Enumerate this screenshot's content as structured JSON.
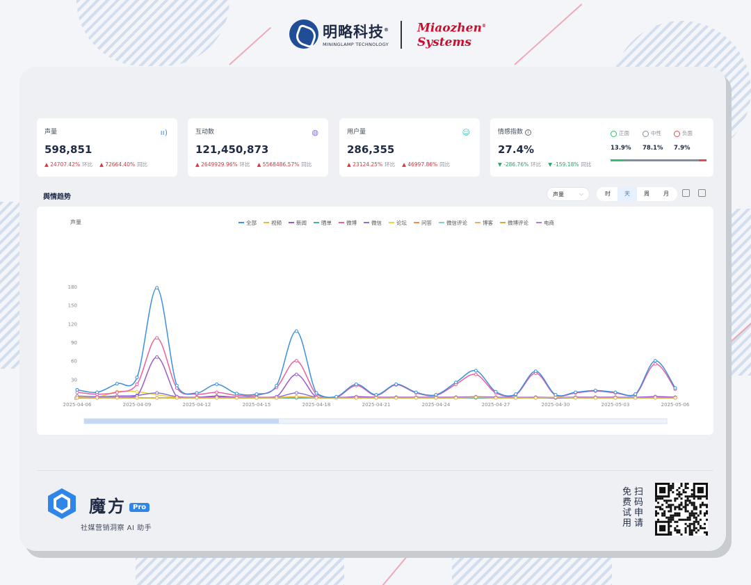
{
  "brand": {
    "partner_cn": "明略科技",
    "partner_reg": "®",
    "partner_en": "MININGLAMP TECHNOLOGY",
    "miaozhen_line1": "Miaozhen",
    "miaozhen_line2": "Systems",
    "miaozhen_reg": "®"
  },
  "kpis": [
    {
      "title": "声量",
      "value": "598,851",
      "chg1": "24707.42%",
      "chg1_label": "环比",
      "chg2": "72664.40%",
      "chg2_label": "同比",
      "icon": "sound-wave-icon"
    },
    {
      "title": "互动数",
      "value": "121,450,873",
      "chg1": "2649929.96%",
      "chg1_label": "环比",
      "chg2": "5568486.57%",
      "chg2_label": "同比",
      "icon": "chat-icon"
    },
    {
      "title": "用户量",
      "value": "286,355",
      "chg1": "23124.25%",
      "chg1_label": "环比",
      "chg2": "46997.86%",
      "chg2_label": "同比",
      "icon": "users-icon"
    }
  ],
  "sentiment": {
    "title": "情感指数",
    "value": "27.4%",
    "chg1": "-286.76%",
    "chg1_label": "环比",
    "chg2": "-159.18%",
    "chg2_label": "同比",
    "positive_label": "正面",
    "positive": "13.9%",
    "neutral_label": "中性",
    "neutral": "78.1%",
    "negative_label": "负面",
    "negative": "7.9%",
    "positive_share": 0.139,
    "neutral_share": 0.781,
    "negative_share": 0.079,
    "colors": {
      "positive": "#2fbf71",
      "neutral": "#7f8fa8",
      "negative": "#e84a4a"
    }
  },
  "trend": {
    "title": "舆情趋势",
    "metric_select": "声量",
    "granularity": [
      "时",
      "天",
      "周",
      "月"
    ],
    "granularity_active": "天"
  },
  "chart_data": {
    "type": "line",
    "ylabel": "声量",
    "ylim": [
      0,
      180
    ],
    "yticks": [
      0,
      30,
      60,
      90,
      120,
      150,
      180
    ],
    "xtick_labels": [
      "2025-04-06",
      "2025-04-09",
      "2025-04-12",
      "2025-04-15",
      "2025-04-18",
      "2025-04-21",
      "2025-04-24",
      "2025-04-27",
      "2025-04-30",
      "2025-05-03",
      "2025-05-06"
    ],
    "x": [
      "04-06",
      "04-07",
      "04-08",
      "04-09",
      "04-10",
      "04-11",
      "04-12",
      "04-13",
      "04-14",
      "04-15",
      "04-16",
      "04-17",
      "04-18",
      "04-19",
      "04-20",
      "04-21",
      "04-22",
      "04-23",
      "04-24",
      "04-25",
      "04-26",
      "04-27",
      "04-28",
      "04-29",
      "04-30",
      "05-01",
      "05-02",
      "05-03",
      "05-04",
      "05-05",
      "05-06"
    ],
    "legend_position": "top-center",
    "series": [
      {
        "name": "全部",
        "color": "#3b8fe0",
        "values": [
          13,
          9,
          23,
          33,
          178,
          20,
          8,
          22,
          7,
          6,
          20,
          108,
          8,
          2,
          22,
          5,
          22,
          9,
          5,
          25,
          44,
          10,
          6,
          43,
          5,
          9,
          12,
          9,
          6,
          60,
          16
        ]
      },
      {
        "name": "视频",
        "color": "#f2b441",
        "values": [
          0,
          0,
          0,
          0,
          0,
          0,
          0,
          0,
          0,
          0,
          0,
          2,
          0,
          0,
          0,
          0,
          0,
          0,
          0,
          0,
          1,
          0,
          0,
          0,
          1,
          0,
          0,
          0,
          0,
          0,
          0
        ]
      },
      {
        "name": "新闻",
        "color": "#9b59d0",
        "values": [
          0,
          0,
          1,
          3,
          66,
          2,
          1,
          2,
          1,
          1,
          2,
          38,
          1,
          0,
          2,
          1,
          1,
          1,
          1,
          1,
          1,
          1,
          0,
          1,
          0,
          1,
          1,
          1,
          0,
          2,
          1
        ]
      },
      {
        "name": "晒单",
        "color": "#41b8a0",
        "values": [
          0,
          0,
          0,
          0,
          0,
          0,
          0,
          0,
          0,
          0,
          0,
          0,
          0,
          0,
          0,
          0,
          0,
          0,
          0,
          0,
          0,
          0,
          0,
          0,
          0,
          0,
          0,
          0,
          0,
          0,
          0
        ]
      },
      {
        "name": "微博",
        "color": "#ec5f9a",
        "values": [
          9,
          6,
          9,
          22,
          97,
          16,
          6,
          9,
          4,
          4,
          17,
          60,
          6,
          1,
          20,
          4,
          21,
          8,
          4,
          22,
          38,
          8,
          5,
          40,
          4,
          8,
          11,
          8,
          5,
          55,
          14
        ]
      },
      {
        "name": "微信",
        "color": "#8a6fd8",
        "values": [
          3,
          2,
          3,
          4,
          8,
          2,
          1,
          3,
          1,
          1,
          1,
          8,
          1,
          1,
          1,
          1,
          1,
          1,
          1,
          1,
          2,
          1,
          1,
          1,
          1,
          1,
          1,
          1,
          1,
          2,
          1
        ]
      },
      {
        "name": "论坛",
        "color": "#e8d23a",
        "values": [
          1,
          1,
          10,
          10,
          5,
          1,
          1,
          3,
          1,
          1,
          1,
          2,
          1,
          0,
          1,
          0,
          1,
          0,
          0,
          1,
          1,
          0,
          0,
          1,
          0,
          0,
          1,
          0,
          0,
          1,
          0
        ]
      },
      {
        "name": "问答",
        "color": "#f08c4a",
        "values": [
          0,
          0,
          0,
          0,
          0,
          0,
          0,
          0,
          0,
          0,
          0,
          0,
          0,
          0,
          0,
          0,
          0,
          0,
          0,
          0,
          0,
          0,
          0,
          0,
          0,
          0,
          0,
          0,
          0,
          0,
          0
        ]
      },
      {
        "name": "微信评论",
        "color": "#7fd1c4",
        "values": [
          0,
          0,
          0,
          0,
          0,
          0,
          0,
          0,
          0,
          0,
          0,
          0,
          0,
          0,
          0,
          0,
          0,
          0,
          0,
          0,
          0,
          0,
          0,
          0,
          0,
          0,
          0,
          0,
          0,
          0,
          0
        ]
      },
      {
        "name": "博客",
        "color": "#f3a96a",
        "values": [
          0,
          0,
          0,
          0,
          0,
          0,
          0,
          0,
          0,
          0,
          0,
          0,
          0,
          0,
          0,
          0,
          0,
          0,
          0,
          0,
          0,
          0,
          0,
          0,
          0,
          0,
          0,
          0,
          0,
          0,
          0
        ]
      },
      {
        "name": "微博评论",
        "color": "#d4a93a",
        "values": [
          0,
          0,
          0,
          0,
          0,
          0,
          0,
          0,
          0,
          0,
          0,
          0,
          0,
          0,
          0,
          0,
          0,
          0,
          0,
          0,
          0,
          0,
          0,
          0,
          0,
          0,
          0,
          0,
          0,
          0,
          0
        ]
      },
      {
        "name": "电商",
        "color": "#b07ad8",
        "values": [
          0,
          0,
          0,
          0,
          0,
          0,
          0,
          0,
          0,
          0,
          0,
          0,
          0,
          0,
          0,
          0,
          0,
          0,
          0,
          0,
          0,
          0,
          0,
          0,
          0,
          0,
          0,
          0,
          0,
          0,
          0
        ]
      }
    ]
  },
  "footer": {
    "product_name": "魔方",
    "product_badge": "Pro",
    "tagline": "社媒营销洞察 AI 助手",
    "cta_col1": "免费试用",
    "cta_col2": "扫码申请"
  }
}
